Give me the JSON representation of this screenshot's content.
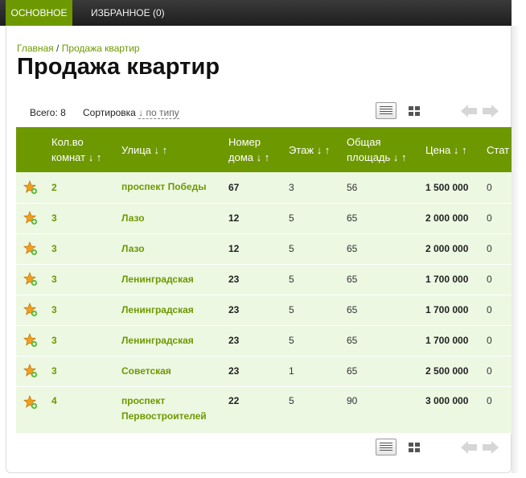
{
  "tabs": {
    "main": "ОСНОВНОЕ",
    "favorites": "ИЗБРАННОЕ (0)"
  },
  "breadcrumb": {
    "home": "Главная",
    "separator": " / ",
    "current": "Продажа квартир"
  },
  "title": "Продажа квартир",
  "summary": {
    "total_label": "Всего: 8",
    "sort_label": "Сортировка",
    "sort_value": "↓ по типу"
  },
  "columns": [
    {
      "line1": "Кол.во",
      "line2": "комнат ↓ ↑"
    },
    {
      "line1": "Улица ↓ ↑",
      "line2": ""
    },
    {
      "line1": "Номер",
      "line2": "дома ↓ ↑"
    },
    {
      "line1": "Этаж ↓ ↑",
      "line2": ""
    },
    {
      "line1": "Общая",
      "line2": "площадь ↓ ↑"
    },
    {
      "line1": "Цена ↓ ↑",
      "line2": ""
    },
    {
      "line1": "Стат",
      "line2": ""
    }
  ],
  "rows": [
    {
      "rooms": "2",
      "street": "проспект Победы",
      "street2": "",
      "house": "67",
      "floor": "3",
      "area": "56",
      "price": "1 500 000",
      "status": "0"
    },
    {
      "rooms": "3",
      "street": "Лазо",
      "street2": "",
      "house": "12",
      "floor": "5",
      "area": "65",
      "price": "2 000 000",
      "status": "0"
    },
    {
      "rooms": "3",
      "street": "Лазо",
      "street2": "",
      "house": "12",
      "floor": "5",
      "area": "65",
      "price": "2 000 000",
      "status": "0"
    },
    {
      "rooms": "3",
      "street": "Ленинградская",
      "street2": "",
      "house": "23",
      "floor": "5",
      "area": "65",
      "price": "1 700 000",
      "status": "0"
    },
    {
      "rooms": "3",
      "street": "Ленинградская",
      "street2": "",
      "house": "23",
      "floor": "5",
      "area": "65",
      "price": "1 700 000",
      "status": "0"
    },
    {
      "rooms": "3",
      "street": "Ленинградская",
      "street2": "",
      "house": "23",
      "floor": "5",
      "area": "65",
      "price": "1 700 000",
      "status": "0"
    },
    {
      "rooms": "3",
      "street": "Советская",
      "street2": "",
      "house": "23",
      "floor": "1",
      "area": "65",
      "price": "2 500 000",
      "status": "0"
    },
    {
      "rooms": "4",
      "street": "проспект",
      "street2": "Первостроителей",
      "house": "22",
      "floor": "5",
      "area": "90",
      "price": "3 000 000",
      "status": "0"
    }
  ],
  "icons": {
    "favorite": "add-to-favorites-star-icon",
    "list_view": "list-view-icon",
    "grid_view": "grid-view-icon",
    "prev": "arrow-left-icon",
    "next": "arrow-right-icon"
  },
  "colors": {
    "accent": "#6e9800",
    "row_bg": "#ecf8e2",
    "topbar": "#2a2a2a"
  }
}
